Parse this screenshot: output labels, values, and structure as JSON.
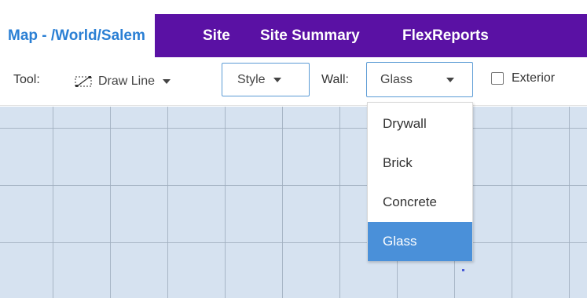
{
  "tabs": [
    {
      "label": "Map - /World/Salem",
      "active": true
    },
    {
      "label": "Site",
      "active": false
    },
    {
      "label": "Site Summary",
      "active": false
    },
    {
      "label": "FlexReports",
      "active": false
    }
  ],
  "toolbar": {
    "tool_label": "Tool:",
    "tool_value": "Draw Line",
    "tool_icon": "draw-line-icon",
    "style_label": "Style",
    "wall_label": "Wall:",
    "wall_value": "Glass",
    "exterior_label": "Exterior",
    "exterior_checked": false
  },
  "wall_dropdown": {
    "options": [
      "Drywall",
      "Brick",
      "Concrete",
      "Glass"
    ],
    "selected": "Glass"
  },
  "colors": {
    "tab_bar": "#5a11a4",
    "active_tab_text": "#2a7fd4",
    "select_border": "#5b9bd5",
    "selected_option": "#4a90d9",
    "map_background": "#d6e2f0"
  }
}
